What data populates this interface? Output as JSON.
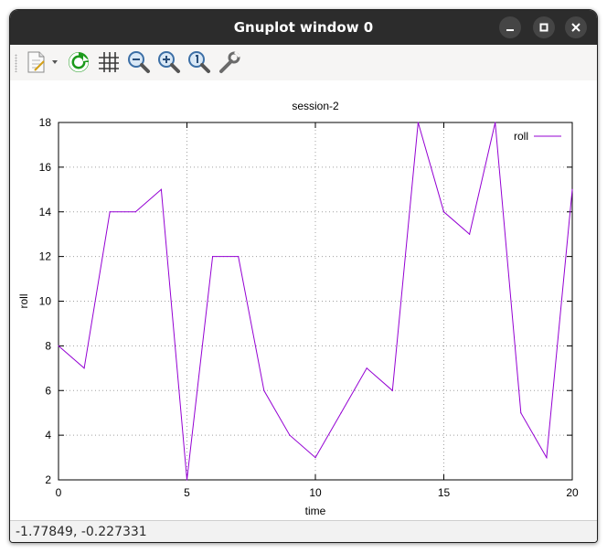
{
  "window": {
    "title": "Gnuplot window 0"
  },
  "toolbar": {
    "icons": [
      "export-icon",
      "dropdown-arrow-icon",
      "replot-icon",
      "grid-icon",
      "zoom-out-icon",
      "zoom-in-icon",
      "zoom-reset-icon",
      "settings-icon"
    ]
  },
  "status": {
    "coordinates": "-1.77849, -0.227331"
  },
  "colors": {
    "series": "#9400d3",
    "titlebar": "#2c2c2c"
  },
  "chart_data": {
    "type": "line",
    "title": "session-2",
    "xlabel": "time",
    "ylabel": "roll",
    "xlim": [
      0,
      20
    ],
    "ylim": [
      2,
      18
    ],
    "xticks": [
      "0",
      "5",
      "10",
      "15",
      "20"
    ],
    "yticks": [
      "2",
      "4",
      "6",
      "8",
      "10",
      "12",
      "14",
      "16",
      "18"
    ],
    "grid": true,
    "legend_position": "top-right",
    "series": [
      {
        "name": "roll",
        "color": "#9400d3",
        "x": [
          0,
          1,
          2,
          3,
          4,
          5,
          6,
          7,
          8,
          9,
          10,
          11,
          12,
          13,
          14,
          15,
          16,
          17,
          18,
          19,
          20
        ],
        "y": [
          8,
          7,
          14,
          14,
          15,
          2,
          12,
          12,
          6,
          4,
          3,
          5,
          7,
          6,
          18,
          14,
          13,
          18,
          5,
          3,
          15
        ]
      }
    ]
  }
}
